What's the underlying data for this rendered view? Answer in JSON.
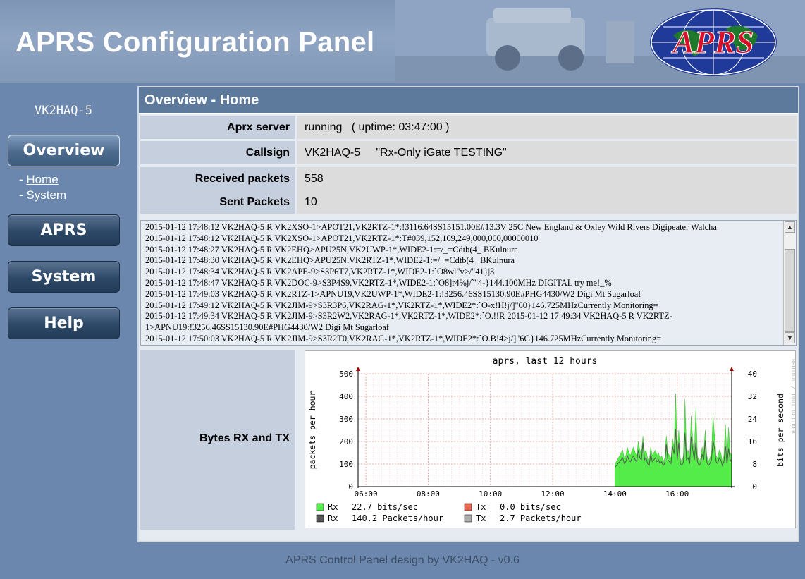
{
  "header": {
    "title": "APRS Configuration Panel",
    "logo_text": "APRS"
  },
  "sidebar": {
    "callsign": "VK2HAQ-5",
    "buttons": {
      "overview": "Overview",
      "aprs": "APRS",
      "system": "System",
      "help": "Help"
    },
    "subnav": {
      "prefix": "- ",
      "home": "Home",
      "system": "System"
    }
  },
  "panel": {
    "title": "Overview - Home",
    "rows": [
      {
        "label": "Aprx server",
        "value": "running   ( uptime: 03:47:00 )"
      },
      {
        "label": "Callsign",
        "value": "VK2HAQ-5     \"Rx-Only iGate TESTING\""
      },
      {
        "label": "Received packets",
        "value": "558"
      },
      {
        "label": "Sent Packets",
        "value": "10"
      }
    ],
    "log": [
      "2015-01-12 17:48:12 VK2HAQ-5 R VK2XSO-1>APOT21,VK2RTZ-1*:!3116.64SS15151.00E#13.3V 25C New England & Oxley Wild Rivers Digipeater Walcha",
      "2015-01-12 17:48:12 VK2HAQ-5 R VK2XSO-1>APOT21,VK2RTZ-1*:T#039,152,169,249,000,000,00000010",
      "2015-01-12 17:48:27 VK2HAQ-5 R VK2EHQ>APU25N,VK2UWP-1*,WIDE2-1:=/_=Cdtb(4_ BKulnura",
      "2015-01-12 17:48:30 VK2HAQ-5 R VK2EHQ>APU25N,VK2RTZ-1*,WIDE2-1:=/_=Cdtb(4_ BKulnura",
      "2015-01-12 17:48:34 VK2HAQ-5 R VK2APE-9>S3P6T7,VK2RTZ-1*,WIDE2-1:`O8wl\"v>/\"41}|3",
      "2015-01-12 17:48:47 VK2HAQ-5 R VK2DOC-9>S3P4S9,VK2RTZ-1*,WIDE2-1:`O8]r4%j/`\"4-}144.100MHz DIGITAL try me!_%",
      "2015-01-12 17:49:03 VK2HAQ-5 R VK2RTZ-1>APNU19,VK2UWP-1*,WIDE2-1:!3256.46SS15130.90E#PHG4430/W2 Digi Mt Sugarloaf",
      "2015-01-12 17:49:12 VK2HAQ-5 R VK2JIM-9>S3R3P6,VK2RAG-1*,VK2RTZ-1*,WIDE2*:`O-x!H!j/]\"60}146.725MHzCurrently Monitoring=",
      "2015-01-12 17:49:34 VK2HAQ-5 R VK2JIM-9>S3R2W2,VK2RAG-1*,VK2RTZ-1*,WIDE2*:`O.!!R 2015-01-12 17:49:34 VK2HAQ-5 R VK2RTZ-1>APNU19:!3256.46SS15130.90E#PHG4430/W2 Digi Mt Sugarloaf",
      "2015-01-12 17:50:03 VK2HAQ-5 R VK2JIM-9>S3R2T0,VK2RAG-1*,VK2RTZ-1*,WIDE2*:`O.B!4>j/]\"6G}146.725MHzCurrently Monitoring="
    ],
    "chart_label": "Bytes RX and TX"
  },
  "chart_data": {
    "type": "area",
    "title": "aprs, last 12 hours",
    "ylabel": "packets per hour",
    "ylabel_right": "bits per second",
    "watermark": "RRDTOOL / TOBI OETIKER",
    "x_ticks": [
      "06:00",
      "08:00",
      "10:00",
      "12:00",
      "14:00",
      "16:00"
    ],
    "y_ticks": [
      "0",
      "100",
      "200",
      "300",
      "400",
      "500"
    ],
    "y_ticks_right": [
      "0",
      "8",
      "16",
      "24",
      "32",
      "40"
    ],
    "ylim": [
      0,
      500
    ],
    "y2lim": [
      0,
      40
    ],
    "grid": true,
    "series_rx_bits_per_sec": [
      8,
      9,
      10,
      11,
      12,
      13,
      10,
      11,
      14,
      12,
      11,
      13,
      14,
      12,
      11,
      16,
      13,
      12,
      18,
      12,
      13,
      10,
      9,
      14,
      11,
      12,
      13,
      11,
      12,
      10,
      11,
      9,
      10,
      18,
      12,
      11,
      10,
      17,
      14,
      33,
      12,
      20,
      10,
      9,
      11,
      31,
      12,
      13,
      10,
      25,
      16,
      12,
      28,
      11,
      9,
      10,
      14,
      12,
      20,
      11,
      9,
      10,
      12,
      25,
      18,
      11,
      10,
      13,
      12,
      9,
      11,
      22,
      10,
      21,
      12,
      11
    ],
    "series_rx_packets_per_hour": [
      100,
      110,
      120,
      130,
      140,
      150,
      120,
      130,
      160,
      140,
      130,
      150,
      160,
      140,
      130,
      190,
      150,
      140,
      230,
      140,
      150,
      120,
      110,
      170,
      130,
      140,
      150,
      130,
      140,
      120,
      130,
      110,
      120,
      220,
      140,
      130,
      120,
      210,
      170,
      300,
      140,
      230,
      120,
      110,
      130,
      280,
      140,
      150,
      120,
      260,
      190,
      140,
      230,
      130,
      110,
      120,
      170,
      140,
      240,
      130,
      110,
      120,
      140,
      240,
      200,
      130,
      120,
      150,
      140,
      110,
      130,
      210,
      120,
      200,
      140,
      130
    ],
    "legend": [
      {
        "name": "Rx",
        "color": "#54ec48",
        "text": "22.7 bits/sec"
      },
      {
        "name": "Tx",
        "color": "#ea644a",
        "text": "0.0 bits/sec"
      },
      {
        "name": "Rx",
        "color": "#555555",
        "text": "140.2 Packets/hour"
      },
      {
        "name": "Tx",
        "color": "#aaaaaa",
        "text": "2.7 Packets/hour"
      }
    ]
  },
  "footer": {
    "text": "APRS Control Panel design by VK2HAQ - v0.6"
  }
}
